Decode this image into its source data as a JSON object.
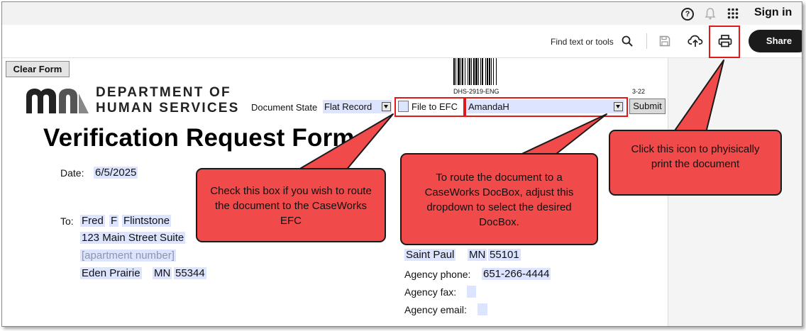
{
  "topbar": {
    "help_icon": "question-circle-icon",
    "notifications_icon": "bell-icon",
    "apps_icon": "app-grid-icon",
    "sign_in_label": "Sign in"
  },
  "toolbar": {
    "find_label": "Find text or tools",
    "search_icon": "search-icon",
    "save_icon": "save-icon",
    "upload_icon": "cloud-upload-icon",
    "print_icon": "printer-icon",
    "share_label": "Share"
  },
  "document": {
    "clear_form_label": "Clear Form",
    "barcode_label": "DHS-2919-ENG",
    "revision_label": "3-22",
    "department_line1": "DEPARTMENT OF",
    "department_line2": "HUMAN SERVICES",
    "document_state_label": "Document State",
    "document_state_value": "Flat Record",
    "file_to_efc_label": "File to EFC",
    "docbox_value": "AmandaH",
    "submit_label": "Submit",
    "title": "Verification Request Form",
    "date_label": "Date:",
    "date_value": "6/5/2025",
    "to_label": "To:",
    "first_name": "Fred",
    "middle_initial": "F",
    "last_name": "Flintstone",
    "street": "123 Main Street Suite",
    "apartment_placeholder": "[apartment number]",
    "city": "Eden Prairie",
    "state": "MN",
    "zip": "55344",
    "agency_city": "Saint Paul",
    "agency_state": "MN",
    "agency_zip": "55101",
    "agency_phone_label": "Agency phone:",
    "agency_phone_value": "651-266-4444",
    "agency_fax_label": "Agency fax:",
    "agency_email_label": "Agency email:"
  },
  "callouts": {
    "efc_text": "Check this box if you wish to route the document to the CaseWorks EFC",
    "docbox_text": "To route the document to a CaseWorks DocBox, adjust this dropdown to select the desired DocBox.",
    "print_text": "Click this icon to phyisically print the document"
  },
  "colors": {
    "callout_fill": "#f04a4a",
    "highlight_border": "#e01a1a",
    "form_field_fill": "#dde4ff",
    "share_button": "#1b1b1b"
  }
}
